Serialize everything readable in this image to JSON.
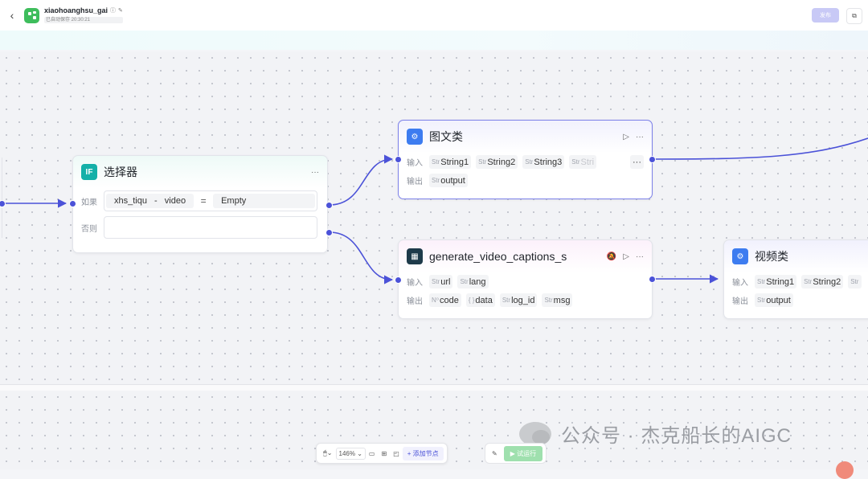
{
  "header": {
    "back_icon": "chevron-left-icon",
    "app_title": "xiaohoanghsu_gai",
    "saved_status": "已自动保存 20:30:21",
    "publish_label": "发布"
  },
  "colors": {
    "accent": "#4b52d8",
    "selector_icon": "#14b0a8",
    "plugin_icon": "#3d7cf0",
    "run_button": "#9fe0ae"
  },
  "nodes": {
    "selector": {
      "icon_text": "IF",
      "title": "选择器",
      "more": "···",
      "if_label": "如果",
      "else_label": "否则",
      "condition": {
        "left": "xhs_tiqu",
        "sep": "-",
        "field": "video",
        "op": "=",
        "right": "Empty"
      }
    },
    "tuwen": {
      "title": "图文类",
      "input_label": "输入",
      "output_label": "输出",
      "inputs": [
        {
          "type": "Str",
          "name": "String1"
        },
        {
          "type": "Str",
          "name": "String2"
        },
        {
          "type": "Str",
          "name": "String3"
        },
        {
          "type": "Str",
          "name": "Stri"
        }
      ],
      "outputs": [
        {
          "type": "Str",
          "name": "output"
        }
      ]
    },
    "captions": {
      "title": "generate_video_captions_s",
      "input_label": "输入",
      "output_label": "输出",
      "inputs": [
        {
          "type": "Str",
          "name": "url"
        },
        {
          "type": "Str",
          "name": "lang"
        }
      ],
      "outputs": [
        {
          "type": "N⁰",
          "name": "code"
        },
        {
          "type": "{ }",
          "name": "data"
        },
        {
          "type": "Str",
          "name": "log_id"
        },
        {
          "type": "Str",
          "name": "msg"
        }
      ]
    },
    "shipin": {
      "title": "视频类",
      "input_label": "输入",
      "output_label": "输出",
      "inputs": [
        {
          "type": "Str",
          "name": "String1"
        },
        {
          "type": "Str",
          "name": "String2"
        },
        {
          "type": "Str",
          "name": ""
        }
      ],
      "outputs": [
        {
          "type": "Str",
          "name": "output"
        }
      ]
    }
  },
  "toolbar": {
    "zoom": "146%",
    "add_node": "添加节点",
    "run": "试运行"
  },
  "watermark": {
    "text": "公众号 · 杰克船长的AIGC"
  }
}
